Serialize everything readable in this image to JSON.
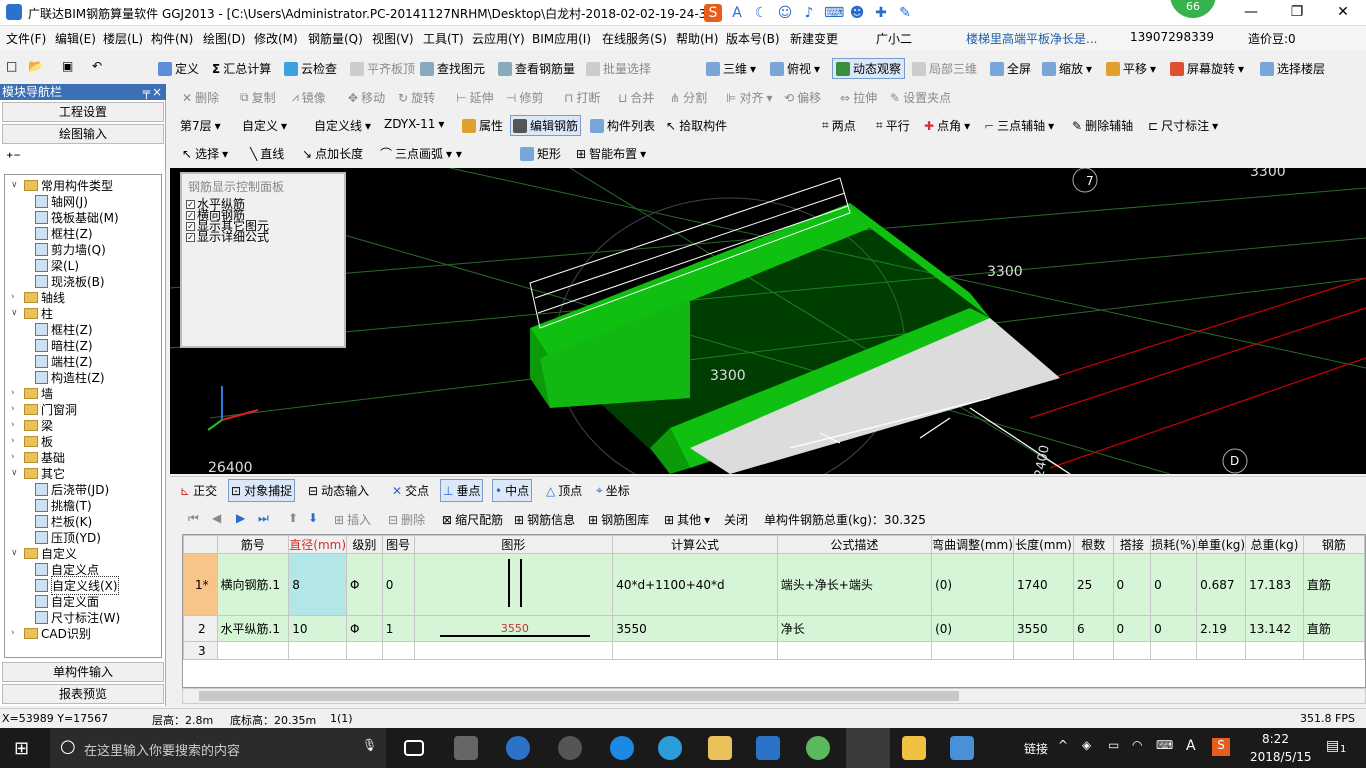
{
  "title": "广联达BIM钢筋算量软件 GGJ2013 - [C:\\Users\\Administrator.PC-20141127NRHM\\Desktop\\白龙村-2018-02-02-19-24-35",
  "badge": "66",
  "menu": [
    "文件(F)",
    "编辑(E)",
    "楼层(L)",
    "构件(N)",
    "绘图(D)",
    "修改(M)",
    "钢筋量(Q)",
    "视图(V)",
    "工具(T)",
    "云应用(Y)",
    "BIM应用(I)",
    "在线服务(S)",
    "帮助(H)",
    "版本号(B)",
    "新建变更",
    "广小二",
    "楼梯里高端平板净长是...",
    "13907298339",
    "造价豆:0"
  ],
  "toolbar1": [
    "定义",
    "汇总计算",
    "云检查",
    "平齐板顶",
    "查找图元",
    "查看钢筋量",
    "批量选择",
    "三维",
    "俯视",
    "动态观察",
    "局部三维",
    "全屏",
    "缩放",
    "平移",
    "屏幕旋转",
    "选择楼层"
  ],
  "toolbar2": [
    "删除",
    "复制",
    "镜像",
    "移动",
    "旋转",
    "延伸",
    "修剪",
    "打断",
    "合并",
    "分割",
    "对齐",
    "偏移",
    "拉伸",
    "设置夹点"
  ],
  "toolbar3": {
    "floor": "第7层",
    "type": "自定义",
    "sub": "自定义线",
    "name": "ZDYX-11",
    "items": [
      "属性",
      "编辑钢筋",
      "构件列表",
      "拾取构件"
    ],
    "axis": [
      "两点",
      "平行",
      "点角",
      "三点辅轴",
      "删除辅轴",
      "尺寸标注"
    ]
  },
  "toolbar4": [
    "选择",
    "直线",
    "点加长度",
    "三点画弧",
    "矩形",
    "智能布置"
  ],
  "nav": {
    "header": "模块导航栏",
    "btn1": "工程设置",
    "btn2": "绘图输入",
    "btn3": "单构件输入",
    "btn4": "报表预览"
  },
  "tree": [
    {
      "t": "常用构件类型",
      "lvl": 0,
      "folder": true,
      "open": true
    },
    {
      "t": "轴网(J)",
      "lvl": 1
    },
    {
      "t": "筏板基础(M)",
      "lvl": 1
    },
    {
      "t": "框柱(Z)",
      "lvl": 1
    },
    {
      "t": "剪力墙(Q)",
      "lvl": 1
    },
    {
      "t": "梁(L)",
      "lvl": 1
    },
    {
      "t": "现浇板(B)",
      "lvl": 1
    },
    {
      "t": "轴线",
      "lvl": 0,
      "folder": true
    },
    {
      "t": "柱",
      "lvl": 0,
      "folder": true,
      "open": true
    },
    {
      "t": "框柱(Z)",
      "lvl": 1
    },
    {
      "t": "暗柱(Z)",
      "lvl": 1
    },
    {
      "t": "端柱(Z)",
      "lvl": 1
    },
    {
      "t": "构造柱(Z)",
      "lvl": 1
    },
    {
      "t": "墙",
      "lvl": 0,
      "folder": true
    },
    {
      "t": "门窗洞",
      "lvl": 0,
      "folder": true
    },
    {
      "t": "梁",
      "lvl": 0,
      "folder": true
    },
    {
      "t": "板",
      "lvl": 0,
      "folder": true
    },
    {
      "t": "基础",
      "lvl": 0,
      "folder": true
    },
    {
      "t": "其它",
      "lvl": 0,
      "folder": true,
      "open": true
    },
    {
      "t": "后浇带(JD)",
      "lvl": 1
    },
    {
      "t": "挑檐(T)",
      "lvl": 1
    },
    {
      "t": "栏板(K)",
      "lvl": 1
    },
    {
      "t": "压顶(YD)",
      "lvl": 1
    },
    {
      "t": "自定义",
      "lvl": 0,
      "folder": true,
      "open": true
    },
    {
      "t": "自定义点",
      "lvl": 1
    },
    {
      "t": "自定义线(X)",
      "lvl": 1,
      "sel": true
    },
    {
      "t": "自定义面",
      "lvl": 1
    },
    {
      "t": "尺寸标注(W)",
      "lvl": 1
    },
    {
      "t": "CAD识别",
      "lvl": 0,
      "folder": true
    }
  ],
  "panel": {
    "title": "钢筋显示控制面板",
    "opts": [
      "水平纵筋",
      "横向钢筋",
      "显示其它图元",
      "显示详细公式"
    ]
  },
  "viewport": {
    "dims": [
      "3300",
      "3300",
      "3300",
      "26400",
      "3300",
      "2400"
    ],
    "axes": [
      "7",
      "D"
    ]
  },
  "snap": [
    "正交",
    "对象捕捉",
    "动态输入",
    "交点",
    "垂点",
    "中点",
    "顶点",
    "坐标"
  ],
  "rebarbar": {
    "items": [
      "插入",
      "删除",
      "缩尺配筋",
      "钢筋信息",
      "钢筋图库",
      "其他",
      "关闭"
    ],
    "total": "单构件钢筋总重(kg)：30.325"
  },
  "grid": {
    "headers": [
      "",
      "筋号",
      "直径(mm)",
      "级别",
      "图号",
      "图形",
      "计算公式",
      "公式描述",
      "弯曲调整(mm)",
      "长度(mm)",
      "根数",
      "搭接",
      "损耗(%)",
      "单重(kg)",
      "总重(kg)",
      "钢筋"
    ],
    "rows": [
      [
        "1*",
        "横向钢筋.1",
        "8",
        "Φ",
        "0",
        "",
        "40*d+1100+40*d",
        "端头+净长+端头",
        "(0)",
        "1740",
        "25",
        "0",
        "0",
        "0.687",
        "17.183",
        "直筋"
      ],
      [
        "2",
        "水平纵筋.1",
        "10",
        "Φ",
        "1",
        "3550",
        "3550",
        "净长",
        "(0)",
        "3550",
        "6",
        "0",
        "0",
        "2.19",
        "13.142",
        "直筋"
      ],
      [
        "3",
        "",
        "",
        "",
        "",
        "",
        "",
        "",
        "",
        "",
        "",
        "",
        "",
        "",
        "",
        ""
      ]
    ]
  },
  "status": {
    "coord": "X=53989 Y=17567",
    "floorh": "层高：2.8m",
    "bottom": "底标高：20.35m",
    "count": "1(1)",
    "fps": "351.8 FPS"
  },
  "taskbar": {
    "search": "在这里输入你要搜索的内容",
    "link": "链接",
    "time": "8:22",
    "date": "2018/5/15",
    "notif": "1",
    "ime": "A"
  },
  "colors": {
    "accent": "#3b6fb6",
    "green": "#00c000",
    "rowbg": "#d6f5d6",
    "sel": "#b3e6e6"
  }
}
